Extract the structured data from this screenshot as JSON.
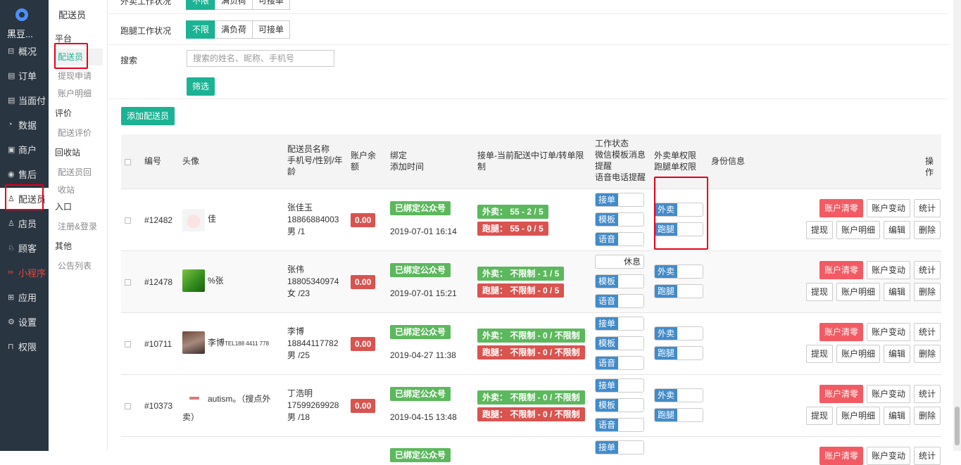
{
  "sidebar": {
    "shop_name": "黑豆...",
    "items": [
      {
        "label": "概况",
        "icon": "dashboard-icon"
      },
      {
        "label": "订单",
        "icon": "order-icon"
      },
      {
        "label": "当面付",
        "icon": "pay-icon"
      },
      {
        "label": "数据",
        "icon": "chart-icon"
      },
      {
        "label": "商户",
        "icon": "shop-icon"
      },
      {
        "label": "售后",
        "icon": "service-icon"
      },
      {
        "label": "配送员",
        "icon": "user-icon",
        "active": true
      },
      {
        "label": "店员",
        "icon": "user-icon"
      },
      {
        "label": "顾客",
        "icon": "customer-icon"
      },
      {
        "label": "小程序",
        "icon": "miniapp-icon"
      },
      {
        "label": "应用",
        "icon": "apps-icon"
      },
      {
        "label": "设置",
        "icon": "gear-icon"
      },
      {
        "label": "权限",
        "icon": "lock-icon"
      }
    ]
  },
  "subnav": {
    "title": "配送员",
    "groups": [
      "平台",
      "评价",
      "回收站",
      "入口",
      "其他"
    ],
    "links": {
      "courier": "配送员",
      "withdraw": "提现申请",
      "account": "账户明细",
      "review": "配送评价",
      "recycle_a": "配送员回",
      "recycle_b": "收站",
      "register": "注册&登录",
      "notice": "公告列表"
    }
  },
  "filters": {
    "takeout_label": "外卖工作状况",
    "errand_label": "跑腿工作状况",
    "options": [
      "不限",
      "满负荷",
      "可接单"
    ],
    "search_label": "搜索",
    "search_placeholder": "搜索的姓名、昵称、手机号",
    "filter_button": "筛选",
    "add_button": "添加配送员"
  },
  "table": {
    "headers": {
      "id": "编号",
      "avatar": "头像",
      "name_1": "配送员名称",
      "name_2": "手机号/性别/年",
      "name_3": "龄",
      "balance_1": "账户余",
      "balance_2": "额",
      "bind_1": "绑定",
      "bind_2": "添加时间",
      "limit_1": "接单-当前配送中订单/转单限",
      "limit_2": "制",
      "status_1": "工作状态",
      "status_2": "微信模板消息",
      "status_3": "提醒",
      "status_4": "语音电话提醒",
      "perm_1": "外卖单权限",
      "perm_2": "跑腿单权限",
      "identity": "身份信息",
      "actions": "操作"
    },
    "labels": {
      "bound": "已绑定公众号",
      "takeout": "外卖",
      "errand": "跑腿",
      "accept": "接单",
      "template": "模板",
      "voice": "语音",
      "rest": "休息",
      "clear": "账户清零",
      "change": "账户变动",
      "stats": "统计",
      "withdraw": "提现",
      "detail": "账户明细",
      "edit": "编辑",
      "delete": "删除"
    },
    "rows": [
      {
        "id": "#12482",
        "nick": "佳",
        "name": "张佳玉",
        "phone": "18866884003",
        "gender_age": "男 /1",
        "balance": "0.00",
        "time": "2019-07-01 16:14",
        "takeout_limit": "外卖： 55 - 2 / 5",
        "errand_limit": "跑腿： 55 - 0 / 5",
        "status": "接单"
      },
      {
        "id": "#12478",
        "nick": "%张",
        "name": "张伟",
        "phone": "18805340974",
        "gender_age": "女 /23",
        "balance": "0.00",
        "time": "2019-07-01 15:21",
        "takeout_limit": "外卖： 不限制 - 1 / 5",
        "errand_limit": "跑腿： 不限制 - 0 / 5",
        "status": "休息"
      },
      {
        "id": "#10711",
        "nick": "李博",
        "nick_extra": "TEL188 4411 778",
        "name": "李博",
        "phone": "18844117782",
        "gender_age": "男 /25",
        "balance": "0.00",
        "time": "2019-04-27 11:38",
        "takeout_limit": "外卖： 不限制 - 0 / 不限制",
        "errand_limit": "跑腿： 不限制 - 0 / 不限制",
        "status": "接单"
      },
      {
        "id": "#10373",
        "nick": "autism。（搜点外",
        "nick_2": "卖）",
        "name": "丁浩明",
        "phone": "17599269928",
        "gender_age": "男 /18",
        "balance": "0.00",
        "time": "2019-04-15 13:48",
        "takeout_limit": "外卖： 不限制 - 0 / 不限制",
        "errand_limit": "跑腿： 不限制 - 0 / 不限制",
        "status": "接单"
      }
    ]
  },
  "colors": {
    "primary": "#1bb394",
    "sidebar": "#2a3542",
    "danger": "#f25b63",
    "switch": "#428bca"
  }
}
